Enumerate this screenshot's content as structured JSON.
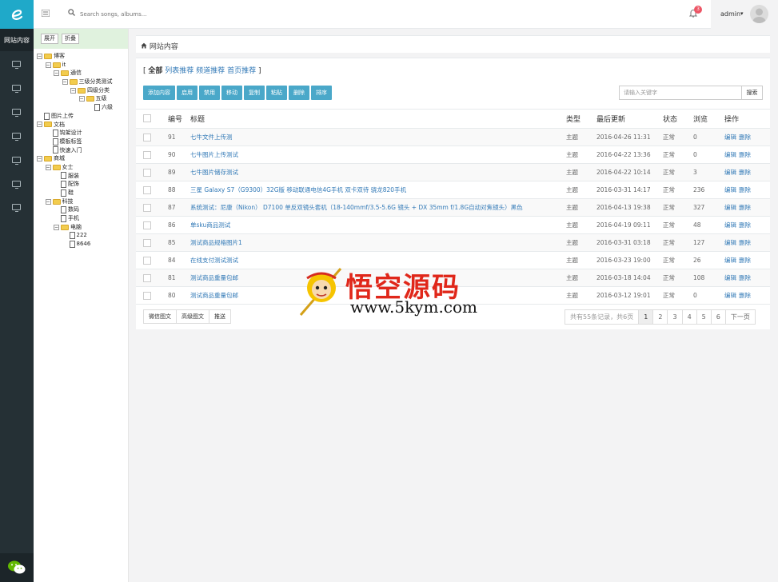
{
  "app": {
    "logo_icon": "e-logo-icon"
  },
  "leftnav": {
    "active_label": "网站内容",
    "icons": [
      "monitor-icon",
      "monitor-icon",
      "monitor-icon",
      "monitor-icon",
      "monitor-icon",
      "monitor-icon",
      "monitor-icon"
    ]
  },
  "topbar": {
    "search_placeholder": "Search songs, albums...",
    "notification_count": "3",
    "username": "admin"
  },
  "tree": {
    "expand_label": "展开",
    "collapse_label": "折叠",
    "nodes": [
      {
        "label": "博客",
        "depth": 0,
        "type": "folder",
        "expanded": true
      },
      {
        "label": "it",
        "depth": 1,
        "type": "folder",
        "expanded": true
      },
      {
        "label": "通信",
        "depth": 2,
        "type": "folder",
        "expanded": true
      },
      {
        "label": "三级分类测试",
        "depth": 3,
        "type": "folder",
        "expanded": true
      },
      {
        "label": "四级分类",
        "depth": 4,
        "type": "folder",
        "expanded": true
      },
      {
        "label": "五级",
        "depth": 5,
        "type": "folder",
        "expanded": true
      },
      {
        "label": "六级",
        "depth": 6,
        "type": "file"
      },
      {
        "label": "图片上传",
        "depth": 0,
        "type": "file"
      },
      {
        "label": "文档",
        "depth": 0,
        "type": "folder",
        "expanded": true
      },
      {
        "label": "钩架设计",
        "depth": 1,
        "type": "file"
      },
      {
        "label": "模板标签",
        "depth": 1,
        "type": "file"
      },
      {
        "label": "快速入门",
        "depth": 1,
        "type": "file"
      },
      {
        "label": "商城",
        "depth": 0,
        "type": "folder",
        "expanded": true
      },
      {
        "label": "女士",
        "depth": 1,
        "type": "folder",
        "expanded": true
      },
      {
        "label": "服装",
        "depth": 2,
        "type": "file"
      },
      {
        "label": "配饰",
        "depth": 2,
        "type": "file"
      },
      {
        "label": "鞋",
        "depth": 2,
        "type": "file"
      },
      {
        "label": "科技",
        "depth": 1,
        "type": "folder",
        "expanded": true
      },
      {
        "label": "数码",
        "depth": 2,
        "type": "file"
      },
      {
        "label": "手机",
        "depth": 2,
        "type": "file"
      },
      {
        "label": "电脑",
        "depth": 2,
        "type": "folder",
        "expanded": true
      },
      {
        "label": "222",
        "depth": 3,
        "type": "file"
      },
      {
        "label": "8646",
        "depth": 3,
        "type": "file"
      }
    ]
  },
  "breadcrumb": {
    "icon": "home-icon",
    "label": "网站内容"
  },
  "filters": {
    "open": "[",
    "all": "全部",
    "list_rec": "列表推荐",
    "channel_rec": "频道推荐",
    "home_rec": "首页推荐",
    "close": "]"
  },
  "toolbar": [
    "添加内容",
    "启用",
    "禁用",
    "移动",
    "复制",
    "粘贴",
    "删除",
    "排序"
  ],
  "search": {
    "placeholder": "请输入关键字",
    "button": "搜索"
  },
  "table": {
    "headers": {
      "id": "编号",
      "title": "标题",
      "type": "类型",
      "updated": "最后更新",
      "status": "状态",
      "views": "浏览",
      "ops": "操作"
    },
    "edit_label": "编辑",
    "delete_label": "删除",
    "rows": [
      {
        "id": "91",
        "title": "七牛文件上传测",
        "type": "主题",
        "updated": "2016-04-26 11:31",
        "status": "正常",
        "views": "0"
      },
      {
        "id": "90",
        "title": "七牛图片上传测试",
        "type": "主题",
        "updated": "2016-04-22 13:36",
        "status": "正常",
        "views": "0"
      },
      {
        "id": "89",
        "title": "七牛图片储存测试",
        "type": "主题",
        "updated": "2016-04-22 10:14",
        "status": "正常",
        "views": "3"
      },
      {
        "id": "88",
        "title": "三星 Galaxy S7（G9300）32G版 移动联通电信4G手机 双卡双待 骁龙820手机",
        "type": "主题",
        "updated": "2016-03-31 14:17",
        "status": "正常",
        "views": "236"
      },
      {
        "id": "87",
        "title": "系统测试：尼康（Nikon） D7100 单反双镜头套机（18-140mmf/3.5-5.6G 镜头 + DX 35mm f/1.8G自动对焦镜头）黑色",
        "type": "主题",
        "updated": "2016-04-13 19:38",
        "status": "正常",
        "views": "327"
      },
      {
        "id": "86",
        "title": "单sku商品测试",
        "type": "主题",
        "updated": "2016-04-19 09:11",
        "status": "正常",
        "views": "48"
      },
      {
        "id": "85",
        "title": "测试商品规格图片1",
        "type": "主题",
        "updated": "2016-03-31 03:18",
        "status": "正常",
        "views": "127"
      },
      {
        "id": "84",
        "title": "在线支付测试测试",
        "type": "主题",
        "updated": "2016-03-23 19:00",
        "status": "正常",
        "views": "26"
      },
      {
        "id": "81",
        "title": "测试商品重量包邮",
        "type": "主题",
        "updated": "2016-03-18 14:04",
        "status": "正常",
        "views": "108"
      },
      {
        "id": "80",
        "title": "测试商品重量包邮",
        "type": "主题",
        "updated": "2016-03-12 19:01",
        "status": "正常",
        "views": "0"
      }
    ]
  },
  "footer_buttons": [
    "微信图文",
    "高级图文",
    "推送"
  ],
  "pager": {
    "info": "共有55条记录，共6页",
    "pages": [
      "1",
      "2",
      "3",
      "4",
      "5",
      "6"
    ],
    "current": "1",
    "next": "下一页"
  },
  "watermark": {
    "cn": "悟空源码",
    "url": "www.5kym.com"
  },
  "colors": {
    "sidebar": "#253035",
    "accent": "#1fa9c9",
    "button": "#4aa8c9",
    "link": "#337ab7",
    "badge": "#ed5565",
    "tree_header": "#e0f2de"
  }
}
